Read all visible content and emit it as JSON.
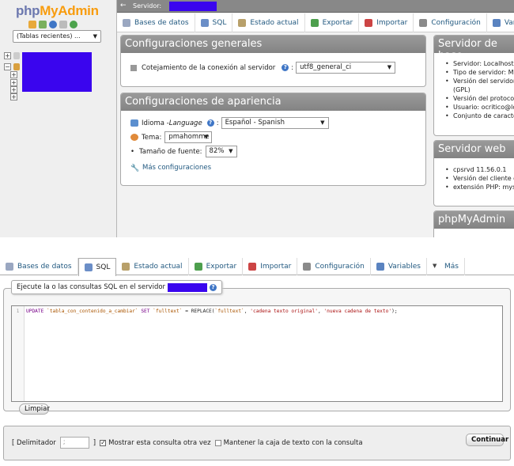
{
  "app": {
    "logo_part1": "php",
    "logo_part2": "MyAdmin"
  },
  "nav": {
    "recent_label": "(Tablas recientes) ...",
    "nav_icons": [
      "home-icon",
      "exit-icon",
      "help-icon",
      "docs-icon",
      "reload-icon"
    ]
  },
  "server_bar": {
    "back": "←",
    "label": "Servidor:"
  },
  "top_menu": {
    "tabs": [
      {
        "label": "Bases de datos",
        "icon": "database-icon",
        "color": "#9aa7c1"
      },
      {
        "label": "SQL",
        "icon": "sql-icon",
        "color": "#6b8ec7"
      },
      {
        "label": "Estado actual",
        "icon": "status-icon",
        "color": "#b8a06a"
      },
      {
        "label": "Exportar",
        "icon": "export-icon",
        "color": "#4d9f4d"
      },
      {
        "label": "Importar",
        "icon": "import-icon",
        "color": "#c44"
      },
      {
        "label": "Configuración",
        "icon": "wrench-icon",
        "color": "#8a8a8a"
      },
      {
        "label": "Variables",
        "icon": "variables-icon",
        "color": "#5a83c0"
      }
    ]
  },
  "general": {
    "title": "Configuraciones generales",
    "collation_label": "Cotejamiento de la conexión al servidor",
    "collation_value": "utf8_general_ci"
  },
  "appearance": {
    "title": "Configuraciones de apariencia",
    "language_label": "Idioma - ",
    "language_italic": "Language",
    "language_value": "Español - Spanish",
    "theme_label": "Tema:",
    "theme_value": "pmahomme",
    "fontsize_label": "Tamaño de fuente:",
    "fontsize_value": "82%",
    "more_label": "Más configuraciones"
  },
  "db_server": {
    "title": "Servidor de base",
    "items": [
      "Servidor: Localhost v",
      "Tipo de servidor: MyS",
      "Versión del servidor:",
      "(GPL)",
      "Versión del protocolo",
      "Usuario: ocritico@loc",
      "Conjunto de caractere"
    ]
  },
  "web_server": {
    "title": "Servidor web",
    "items": [
      "cpsrvd 11.56.0.1",
      "Versión del cliente de",
      "extensión PHP: mysq"
    ]
  },
  "pma": {
    "title": "phpMyAdmin"
  },
  "bottom_menu": {
    "tabs": [
      {
        "label": "Bases de datos",
        "icon": "database-icon",
        "color": "#9aa7c1",
        "active": false
      },
      {
        "label": "SQL",
        "icon": "sql-icon",
        "color": "#6b8ec7",
        "active": true
      },
      {
        "label": "Estado actual",
        "icon": "status-icon",
        "color": "#b8a06a",
        "active": false
      },
      {
        "label": "Exportar",
        "icon": "export-icon",
        "color": "#4d9f4d",
        "active": false
      },
      {
        "label": "Importar",
        "icon": "import-icon",
        "color": "#c44",
        "active": false
      },
      {
        "label": "Configuración",
        "icon": "wrench-icon",
        "color": "#8a8a8a",
        "active": false
      },
      {
        "label": "Variables",
        "icon": "variables-icon",
        "color": "#5a83c0",
        "active": false
      },
      {
        "label": "Más",
        "icon": "caret-down-icon",
        "color": "#444",
        "active": false
      }
    ]
  },
  "sql_panel": {
    "legend": "Ejecute la o las consultas SQL en el servidor",
    "line_number": "1",
    "code": {
      "kw1": "UPDATE",
      "tbl": "`tabla_con_contenido_a_cambiar`",
      "kw2": "SET",
      "col1": "`fulltext`",
      "eq": "=",
      "fn": "REPLACE(",
      "col2": "`fulltext`",
      "comma1": ",",
      "str1": "'cadena texto original'",
      "comma2": ",",
      "str2": "'nueva cadena de texto'",
      "end": ");"
    },
    "clear_button": "Limpiar"
  },
  "footer": {
    "delimiter_label": "[ Delimitador",
    "delimiter_value": ";",
    "bracket_close": "]",
    "show_query_label": "Mostrar esta consulta otra vez",
    "show_query_checked": true,
    "keep_box_label": "Mantener la caja de texto con la consulta",
    "keep_box_checked": false,
    "continue_button": "Continuar"
  },
  "colors": {
    "redaction": "#3a05ee",
    "link": "#235a81",
    "panel_header": "#8e8e8e"
  }
}
